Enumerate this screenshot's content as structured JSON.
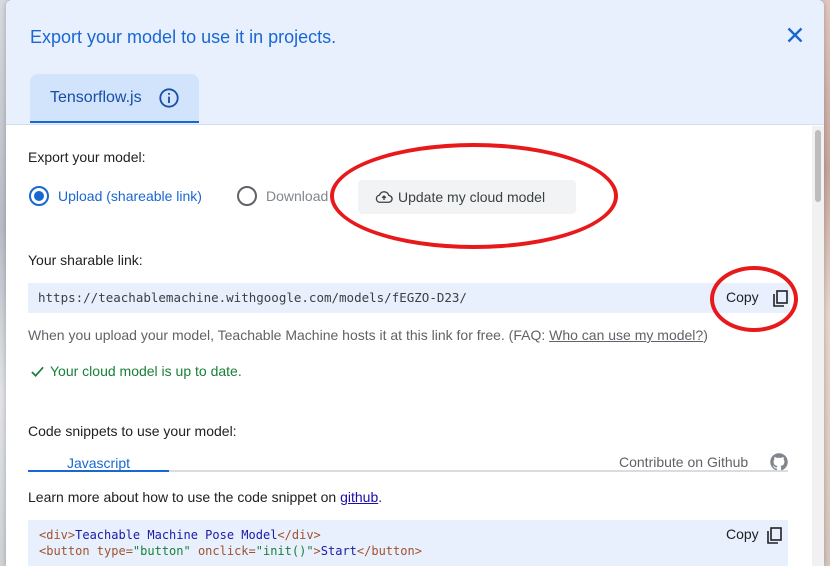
{
  "dialog": {
    "title": "Export your model to use it in projects.",
    "tab": {
      "label": "Tensorflow.js"
    }
  },
  "export": {
    "heading": "Export your model:",
    "options": [
      {
        "label": "Upload (shareable link)",
        "selected": true
      },
      {
        "label": "Download",
        "selected": false
      }
    ],
    "update_button": "Update my cloud model"
  },
  "link": {
    "heading": "Your sharable link:",
    "url": "https://teachablemachine.withgoogle.com/models/fEGZO-D23/",
    "copy_label": "Copy",
    "note_prefix": "When you upload your model, Teachable Machine hosts it at this link for free. (FAQ: ",
    "note_link": "Who can use my model?",
    "note_suffix": ")",
    "status": "Your cloud model is up to date."
  },
  "snippets": {
    "heading": "Code snippets to use your model:",
    "tab": "Javascript",
    "github_link": "Contribute on Github",
    "learn_prefix": "Learn more about how to use the code snippet on ",
    "learn_link": "github",
    "learn_suffix": ".",
    "copy_label": "Copy",
    "code_line1": {
      "open": "<div>",
      "text": "Teachable Machine Pose Model",
      "close": "</div>"
    },
    "code_line2": {
      "open": "<button type=",
      "str1": "\"button\"",
      "mid": " onclick=",
      "str2": "\"init()\"",
      "gt": ">",
      "text": "Start",
      "close": "</button>"
    }
  },
  "colors": {
    "accent": "#1967d2",
    "success": "#188038",
    "highlight_ring": "#e8191b"
  }
}
